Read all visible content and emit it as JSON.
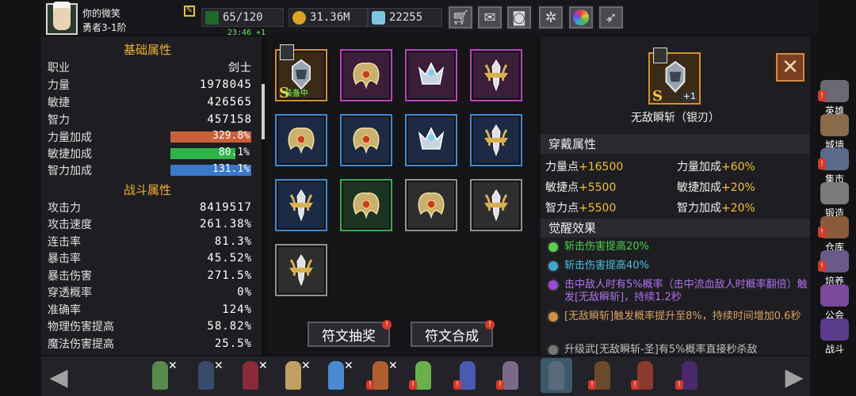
{
  "player": {
    "name": "你的微笑",
    "rank": "勇者3-1阶"
  },
  "resources": {
    "stamina": "65/120",
    "timer": "23:46 +1",
    "gold": "31.36M",
    "gems": "22255"
  },
  "toolbar": {
    "icons": [
      "shop-cart-icon",
      "mail-icon",
      "gamepad-icon",
      "gear-icon",
      "color-wheel-icon",
      "feather-icon"
    ]
  },
  "base_attrs": {
    "header": "基础属性",
    "rows": [
      {
        "label": "职业",
        "value": "剑士"
      },
      {
        "label": "力量",
        "value": "1978045"
      },
      {
        "label": "敏捷",
        "value": "426565"
      },
      {
        "label": "智力",
        "value": "457158"
      }
    ],
    "bars": [
      {
        "label": "力量加成",
        "value": "329.8%",
        "fill": 1.0,
        "color": "#c8603a"
      },
      {
        "label": "敏捷加成",
        "value": "80.1%",
        "fill": 0.801,
        "color": "#2fb24a"
      },
      {
        "label": "智力加成",
        "value": "131.1%",
        "fill": 1.0,
        "color": "#3a78c8"
      }
    ]
  },
  "combat_attrs": {
    "header": "战斗属性",
    "rows": [
      {
        "label": "攻击力",
        "value": "8419517"
      },
      {
        "label": "攻击速度",
        "value": "261.38%"
      },
      {
        "label": "连击率",
        "value": "81.3%"
      },
      {
        "label": "暴击率",
        "value": "45.52%"
      },
      {
        "label": "暴击伤害",
        "value": "271.5%"
      },
      {
        "label": "穿透概率",
        "value": "0%"
      },
      {
        "label": "准确率",
        "value": "124%"
      },
      {
        "label": "物理伤害提高",
        "value": "58.82%"
      },
      {
        "label": "魔法伤害提高",
        "value": "25.5%"
      }
    ]
  },
  "runes": {
    "equipped_label": "装备中",
    "grade": "S",
    "level": "+1",
    "draw_label": "符文抽奖",
    "merge_label": "符文合成"
  },
  "detail": {
    "name": "无敌瞬斩（银刃）",
    "grade": "S",
    "level": "+1",
    "wear_header": "穿戴属性",
    "wear": [
      {
        "k": "力量点",
        "v": "+16500"
      },
      {
        "k": "力量加成",
        "v": "+60%"
      },
      {
        "k": "敏捷点",
        "v": "+5500"
      },
      {
        "k": "敏捷加成",
        "v": "+20%"
      },
      {
        "k": "智力点",
        "v": "+5500"
      },
      {
        "k": "智力加成",
        "v": "+20%"
      }
    ],
    "awaken_header": "觉醒效果",
    "effects": [
      {
        "text": "斩击伤害提高20%",
        "color": "#4ad04a",
        "dot": "#5ad04a"
      },
      {
        "text": "斩击伤害提高40%",
        "color": "#4ac0e0",
        "dot": "#3aa8d0"
      },
      {
        "text": "击中敌人时有5%概率（击中流血敌人时概率翻倍）触发[无敌瞬斩]，持续1.2秒",
        "color": "#b070f0",
        "dot": "#9a4ad8"
      },
      {
        "text": "[无敌瞬斩]触发概率提升至8%，持续时间增加0.6秒",
        "color": "#d8a060",
        "dot": "#d09040"
      },
      {
        "text": "升级武[无敌瞬斩-圣]有5%概率直接秒杀敌",
        "color": "#c0c0c0",
        "dot": "#777"
      }
    ]
  },
  "sidebar": {
    "items": [
      {
        "label": "英雄",
        "alert": true
      },
      {
        "label": "城墙",
        "alert": false
      },
      {
        "label": "集市",
        "alert": true
      },
      {
        "label": "锻造",
        "alert": false
      },
      {
        "label": "仓库",
        "alert": true
      },
      {
        "label": "培养",
        "alert": true
      },
      {
        "label": "公会",
        "alert": false
      },
      {
        "label": "战斗",
        "alert": false
      }
    ]
  },
  "alert_mark": "!",
  "remove_mark": "✕"
}
